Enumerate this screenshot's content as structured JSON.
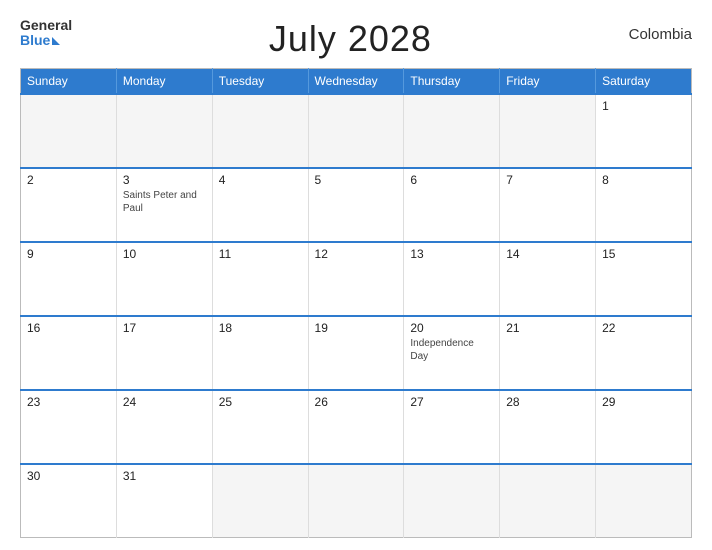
{
  "header": {
    "logo_general": "General",
    "logo_blue": "Blue",
    "title": "July 2028",
    "country": "Colombia"
  },
  "weekdays": [
    "Sunday",
    "Monday",
    "Tuesday",
    "Wednesday",
    "Thursday",
    "Friday",
    "Saturday"
  ],
  "weeks": [
    [
      {
        "day": "",
        "holiday": "",
        "empty": true
      },
      {
        "day": "",
        "holiday": "",
        "empty": true
      },
      {
        "day": "",
        "holiday": "",
        "empty": true
      },
      {
        "day": "",
        "holiday": "",
        "empty": true
      },
      {
        "day": "",
        "holiday": "",
        "empty": true
      },
      {
        "day": "",
        "holiday": "",
        "empty": true
      },
      {
        "day": "1",
        "holiday": ""
      }
    ],
    [
      {
        "day": "2",
        "holiday": ""
      },
      {
        "day": "3",
        "holiday": "Saints Peter and Paul"
      },
      {
        "day": "4",
        "holiday": ""
      },
      {
        "day": "5",
        "holiday": ""
      },
      {
        "day": "6",
        "holiday": ""
      },
      {
        "day": "7",
        "holiday": ""
      },
      {
        "day": "8",
        "holiday": ""
      }
    ],
    [
      {
        "day": "9",
        "holiday": ""
      },
      {
        "day": "10",
        "holiday": ""
      },
      {
        "day": "11",
        "holiday": ""
      },
      {
        "day": "12",
        "holiday": ""
      },
      {
        "day": "13",
        "holiday": ""
      },
      {
        "day": "14",
        "holiday": ""
      },
      {
        "day": "15",
        "holiday": ""
      }
    ],
    [
      {
        "day": "16",
        "holiday": ""
      },
      {
        "day": "17",
        "holiday": ""
      },
      {
        "day": "18",
        "holiday": ""
      },
      {
        "day": "19",
        "holiday": ""
      },
      {
        "day": "20",
        "holiday": "Independence Day"
      },
      {
        "day": "21",
        "holiday": ""
      },
      {
        "day": "22",
        "holiday": ""
      }
    ],
    [
      {
        "day": "23",
        "holiday": ""
      },
      {
        "day": "24",
        "holiday": ""
      },
      {
        "day": "25",
        "holiday": ""
      },
      {
        "day": "26",
        "holiday": ""
      },
      {
        "day": "27",
        "holiday": ""
      },
      {
        "day": "28",
        "holiday": ""
      },
      {
        "day": "29",
        "holiday": ""
      }
    ],
    [
      {
        "day": "30",
        "holiday": ""
      },
      {
        "day": "31",
        "holiday": ""
      },
      {
        "day": "",
        "holiday": "",
        "empty": true
      },
      {
        "day": "",
        "holiday": "",
        "empty": true
      },
      {
        "day": "",
        "holiday": "",
        "empty": true
      },
      {
        "day": "",
        "holiday": "",
        "empty": true
      },
      {
        "day": "",
        "holiday": "",
        "empty": true
      }
    ]
  ]
}
